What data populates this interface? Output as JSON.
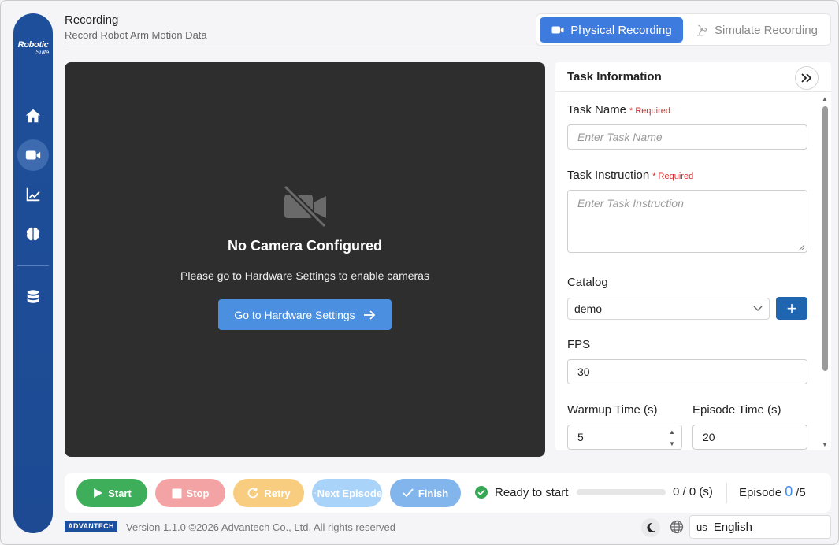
{
  "sidebar": {
    "logo_main": "Robotic",
    "logo_sub": "Suite",
    "items": [
      {
        "icon": "home-icon"
      },
      {
        "icon": "video-camera-icon"
      },
      {
        "icon": "chart-line-icon"
      },
      {
        "icon": "brain-icon"
      },
      {
        "icon": "database-icon"
      }
    ]
  },
  "header": {
    "title": "Recording",
    "subtitle": "Record Robot Arm Motion Data"
  },
  "mode_toggle": {
    "physical_label": "Physical Recording",
    "simulate_label": "Simulate Recording",
    "active": "physical"
  },
  "camera": {
    "title": "No Camera Configured",
    "message": "Please go to Hardware Settings to enable cameras",
    "button_label": "Go to Hardware Settings"
  },
  "task": {
    "panel_title": "Task Information",
    "required_label": "* Required",
    "task_name_label": "Task Name",
    "task_name_placeholder": "Enter Task Name",
    "task_instruction_label": "Task Instruction",
    "task_instruction_placeholder": "Enter Task Instruction",
    "catalog_label": "Catalog",
    "catalog_value": "demo",
    "add_symbol": "+",
    "fps_label": "FPS",
    "fps_value": "30",
    "warmup_label": "Warmup Time (s)",
    "warmup_value": "5",
    "episode_time_label": "Episode Time (s)",
    "episode_time_value": "20"
  },
  "controls": {
    "start_label": "Start",
    "stop_label": "Stop",
    "retry_label": "Retry",
    "next_label": "Next Episode",
    "finish_label": "Finish",
    "status_text": "Ready to start",
    "progress_text": "0 / 0 (s)",
    "progress_fraction": 0,
    "episode_label": "Episode",
    "episode_current": "0",
    "episode_total": "/5",
    "colors": {
      "start": "#3fae5a",
      "stop": "#f3a3a3",
      "retry": "#f9cd7f",
      "next": "#a9d3f8",
      "finish": "#82b5ec",
      "status_ok": "#35a853"
    }
  },
  "footer": {
    "brand": "ADVANTECH",
    "version": "Version 1.1.0 ©2026 Advantech Co., Ltd. All rights reserved",
    "language_code": "us",
    "language_label": "English"
  },
  "colors": {
    "sidebar": "#1e4f9a",
    "accent": "#3d7bde",
    "camera_bg": "#2e2e2e",
    "required": "#d62b2b"
  }
}
